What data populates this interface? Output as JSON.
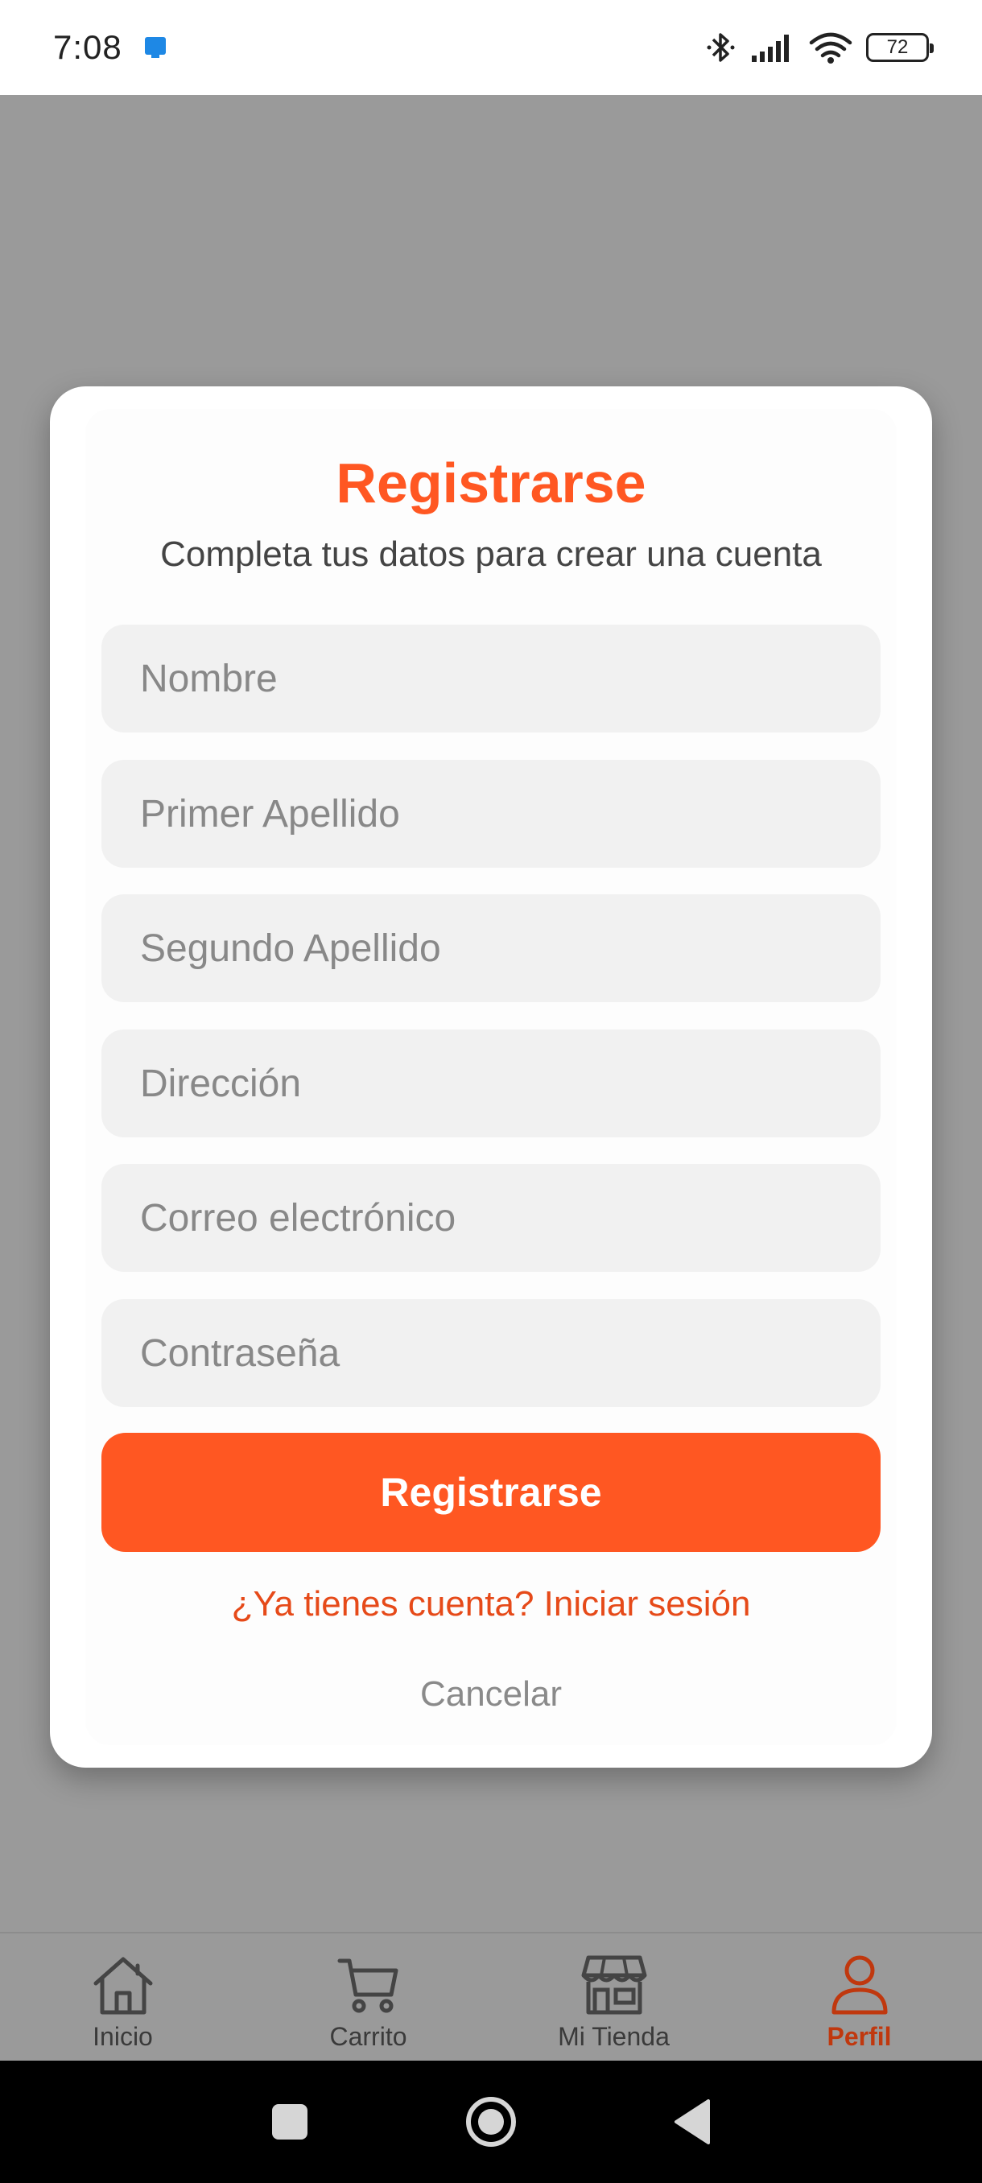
{
  "status_bar": {
    "time": "7:08",
    "battery": "72"
  },
  "dialog": {
    "title": "Registrarse",
    "subtitle": "Completa tus datos para crear una cuenta",
    "fields": [
      {
        "placeholder": "Nombre",
        "value": ""
      },
      {
        "placeholder": "Primer Apellido",
        "value": ""
      },
      {
        "placeholder": "Segundo Apellido",
        "value": ""
      },
      {
        "placeholder": "Dirección",
        "value": ""
      },
      {
        "placeholder": "Correo electrónico",
        "value": ""
      },
      {
        "placeholder": "Contraseña",
        "value": ""
      }
    ],
    "submit_label": "Registrarse",
    "login_link": "¿Ya tienes cuenta? Iniciar sesión",
    "cancel_label": "Cancelar"
  },
  "bottom_nav": {
    "items": [
      {
        "label": "Inicio",
        "icon": "home-icon",
        "active": false
      },
      {
        "label": "Carrito",
        "icon": "cart-icon",
        "active": false
      },
      {
        "label": "Mi Tienda",
        "icon": "store-icon",
        "active": false
      },
      {
        "label": "Perfil",
        "icon": "person-icon",
        "active": true
      }
    ]
  },
  "colors": {
    "accent": "#ff5722",
    "link": "#e64a19",
    "active_nav": "#c0380e",
    "overlay": "#9a9a9a"
  }
}
